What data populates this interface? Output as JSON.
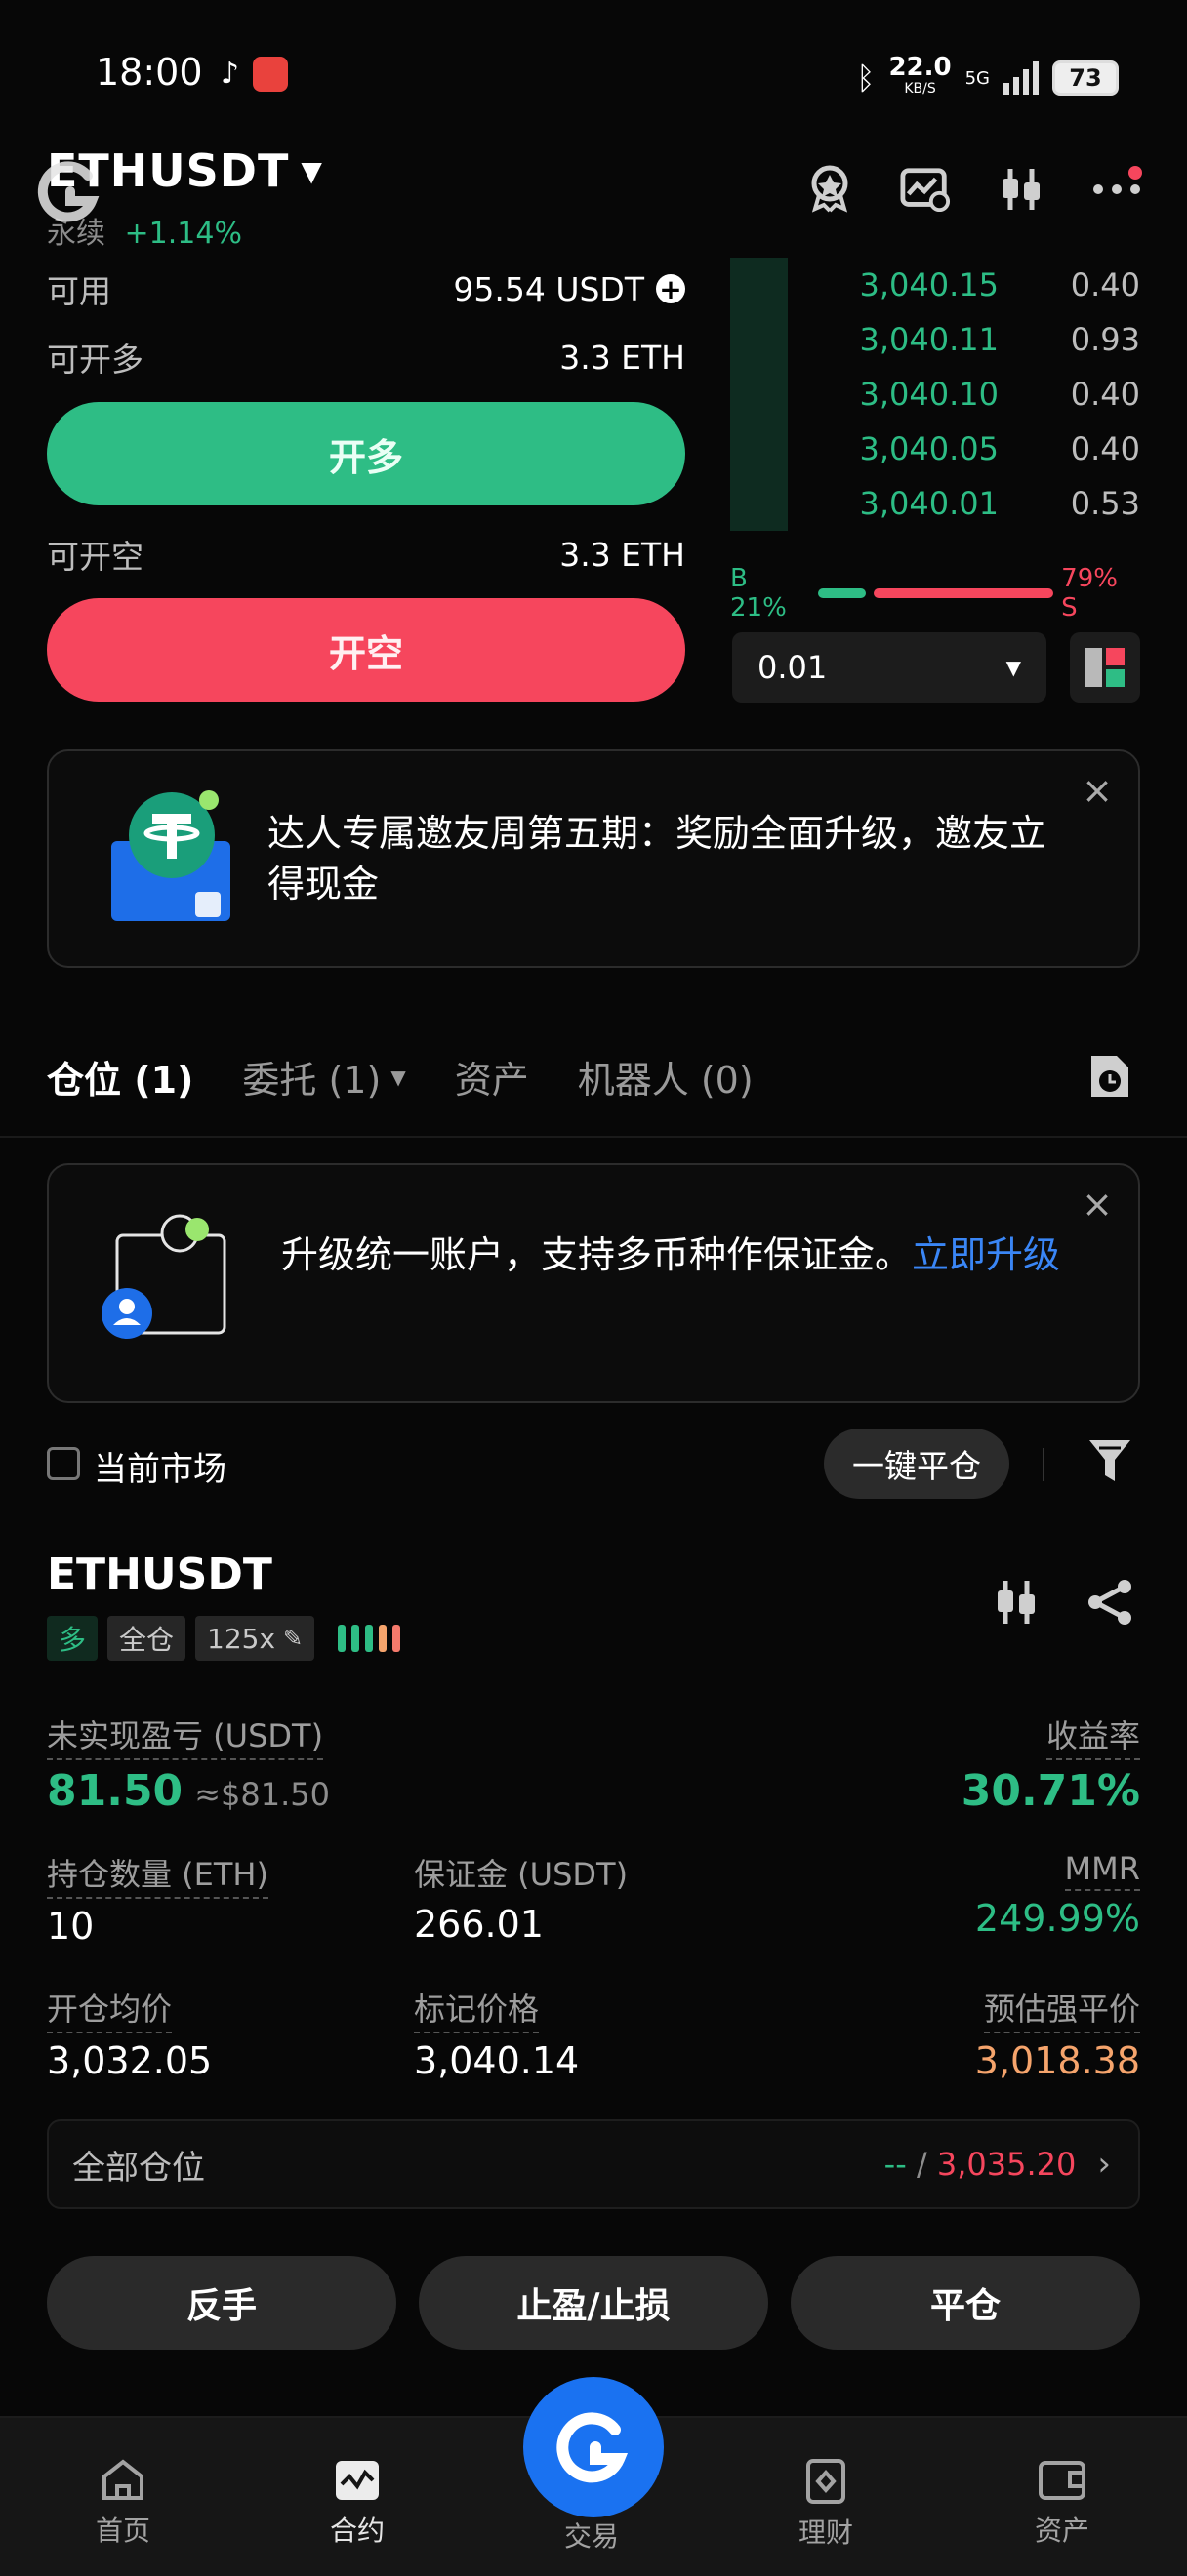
{
  "status_bar": {
    "time": "18:00",
    "net_speed": "22.0",
    "net_unit": "KB/S",
    "net_type": "5G",
    "battery": "73"
  },
  "header": {
    "pair": "ETHUSDT",
    "product": "永续",
    "change": "+1.14%"
  },
  "trade": {
    "available_label": "可用",
    "available_value": "95.54 USDT",
    "can_long_label": "可开多",
    "can_long_value": "3.3 ETH",
    "long_button": "开多",
    "can_short_label": "可开空",
    "can_short_value": "3.3 ETH",
    "short_button": "开空"
  },
  "orderbook": {
    "rows": [
      {
        "price": "3,040.15",
        "amount": "0.40",
        "depth": 0.14
      },
      {
        "price": "3,040.11",
        "amount": "0.93",
        "depth": 0.14
      },
      {
        "price": "3,040.10",
        "amount": "0.40",
        "depth": 0.14
      },
      {
        "price": "3,040.05",
        "amount": "0.40",
        "depth": 0.14
      },
      {
        "price": "3,040.01",
        "amount": "0.53",
        "depth": 0.14
      }
    ],
    "buy_ratio": "B 21%",
    "sell_ratio": "79% S",
    "buy_fraction": 0.21,
    "precision": "0.01"
  },
  "promo1": {
    "text": "达人专属邀友周第五期：奖励全面升级，邀友立得现金"
  },
  "tabs": [
    {
      "label": "仓位 (1)",
      "active": true
    },
    {
      "label": "委托 (1)",
      "active": false
    },
    {
      "label": "资产",
      "active": false
    },
    {
      "label": "机器人 (0)",
      "active": false
    }
  ],
  "promo2": {
    "text": "升级统一账户，支持多币种作保证金。",
    "link": "立即升级"
  },
  "filter": {
    "current_market": "当前市场",
    "close_all": "一键平仓"
  },
  "position": {
    "symbol": "ETHUSDT",
    "side_tag": "多",
    "margin_tag": "全仓",
    "leverage_tag": "125x",
    "unrealized_label": "未实现盈亏 (USDT)",
    "unrealized_value": "81.50",
    "unrealized_usd": "≈$81.50",
    "roe_label": "收益率",
    "roe_value": "30.71%",
    "qty_label": "持仓数量 (ETH)",
    "qty_value": "10",
    "margin_label": "保证金 (USDT)",
    "margin_value": "266.01",
    "mmr_label": "MMR",
    "mmr_value": "249.99%",
    "entry_label": "开仓均价",
    "entry_value": "3,032.05",
    "mark_label": "标记价格",
    "mark_value": "3,040.14",
    "liq_label": "预估强平价",
    "liq_value": "3,018.38"
  },
  "all_positions": {
    "label": "全部仓位",
    "value_a": "--",
    "sep": " / ",
    "value_b": "3,035.20"
  },
  "actions": {
    "reverse": "反手",
    "tpsl": "止盈/止损",
    "close": "平仓"
  },
  "nav": {
    "home": "首页",
    "futures": "合约",
    "trade": "交易",
    "earn": "理财",
    "assets": "资产"
  },
  "colors": {
    "green": "#2ebd85",
    "red": "#f6465d",
    "orange": "#f5a46c",
    "blue": "#1a72f1"
  }
}
